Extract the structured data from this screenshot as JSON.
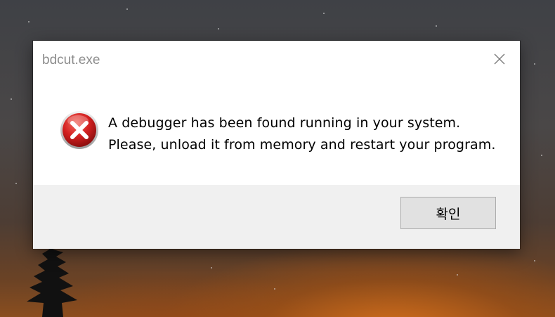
{
  "window": {
    "title": "bdcut.exe",
    "close_icon": "close-icon"
  },
  "message": {
    "icon": "error-icon",
    "line1": "A debugger has been found running in your system.",
    "line2": "Please, unload it from memory and restart your program."
  },
  "footer": {
    "ok_label": "확인"
  },
  "colors": {
    "dialog_bg": "#ffffff",
    "footer_bg": "#f0f0f0",
    "title_text": "#8c8c8c",
    "error_red": "#d42020",
    "button_bg": "#e1e1e1",
    "button_border": "#adadad"
  }
}
